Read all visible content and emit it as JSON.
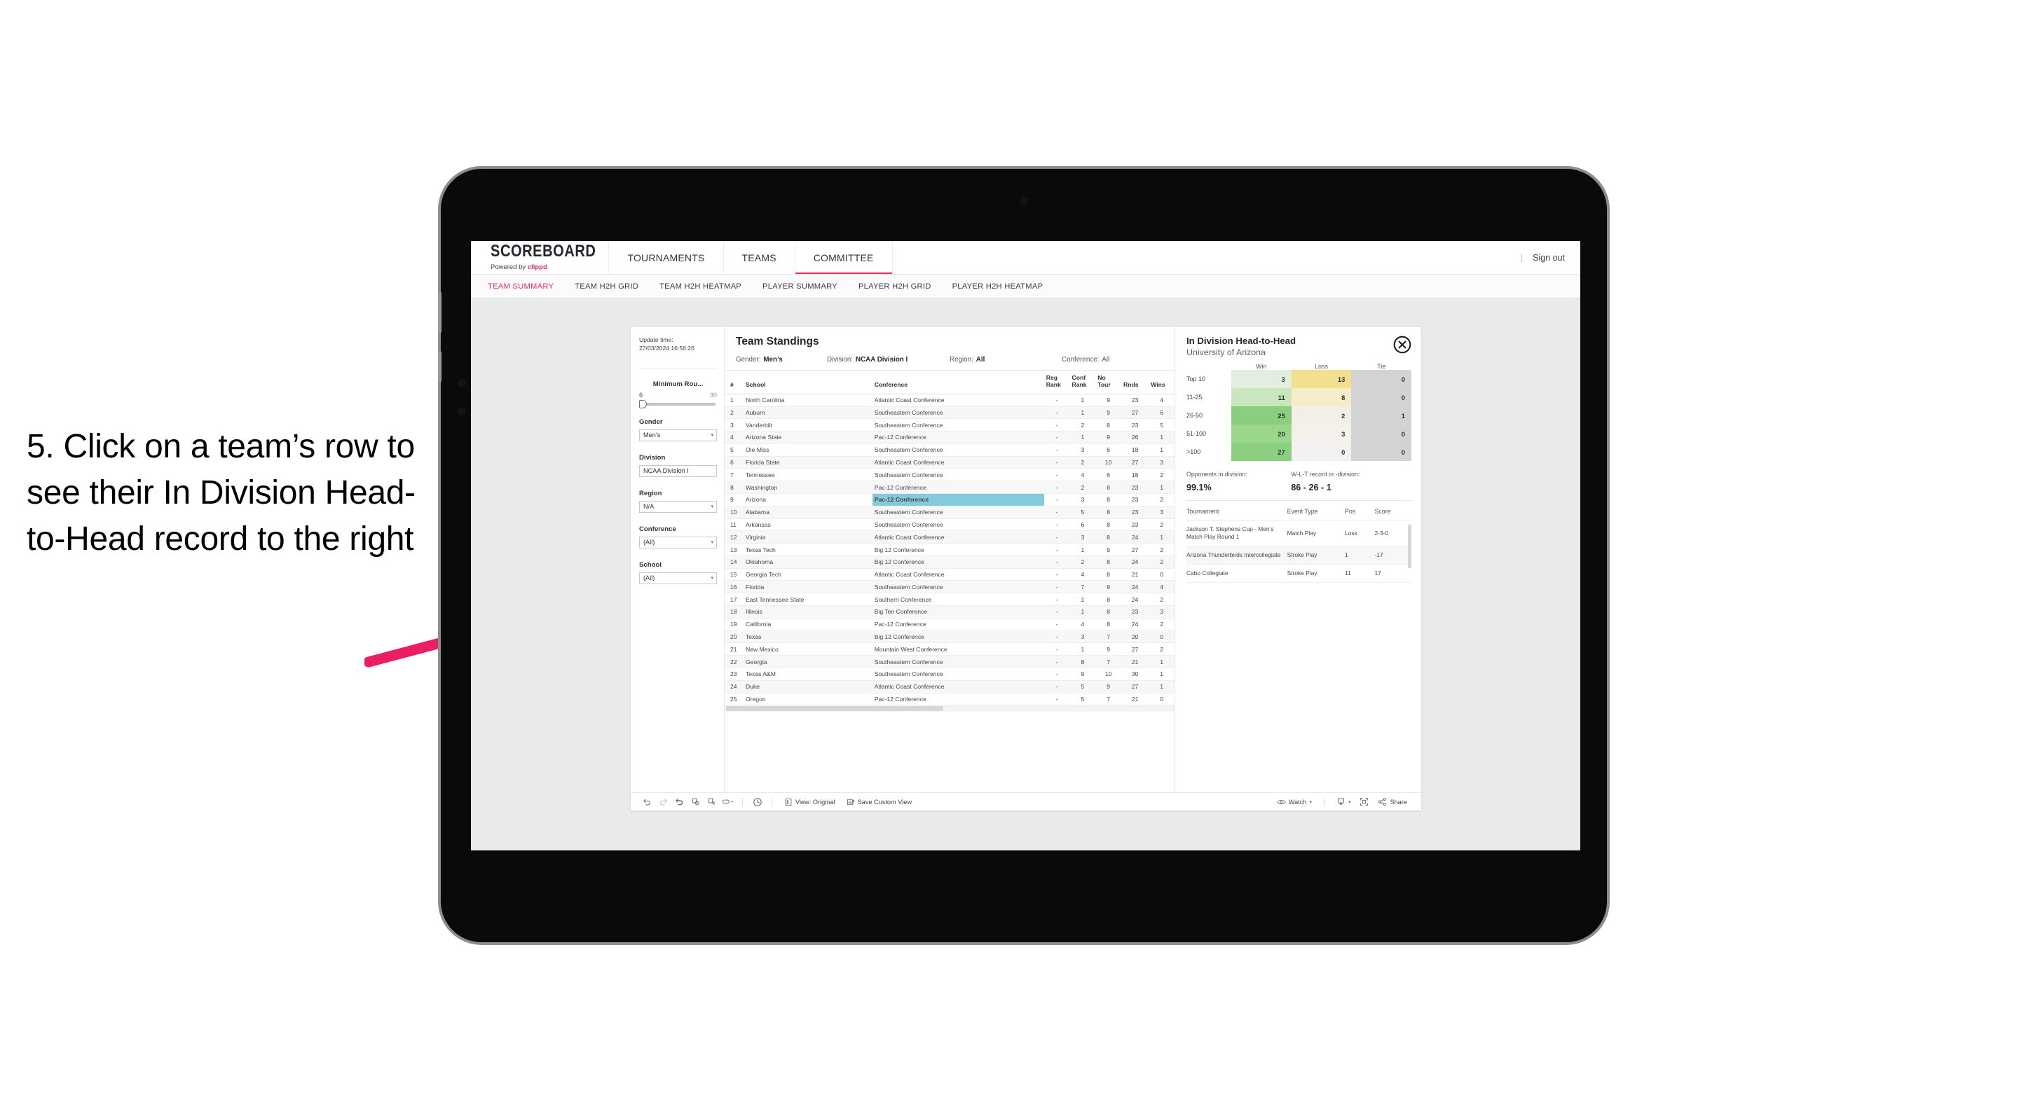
{
  "annotation": {
    "text": "5. Click on a team’s row to see their In Division Head-to-Head record to the right",
    "arrow_color": "#ec1e63"
  },
  "topnav": {
    "brand_title": "SCOREBOARD",
    "brand_sub_prefix": "Powered by ",
    "brand_sub_brand": "clippd",
    "items": [
      {
        "label": "TOURNAMENTS",
        "active": false
      },
      {
        "label": "TEAMS",
        "active": false
      },
      {
        "label": "COMMITTEE",
        "active": true
      }
    ],
    "separator": "|",
    "sign_out": "Sign out",
    "accent_color": "#ef2b5c"
  },
  "subnav": {
    "items": [
      {
        "label": "TEAM SUMMARY",
        "active": true
      },
      {
        "label": "TEAM H2H GRID",
        "active": false
      },
      {
        "label": "TEAM H2H HEATMAP",
        "active": false
      },
      {
        "label": "PLAYER SUMMARY",
        "active": false
      },
      {
        "label": "PLAYER H2H GRID",
        "active": false
      },
      {
        "label": "PLAYER H2H HEATMAP",
        "active": false
      }
    ]
  },
  "filters": {
    "update_time_label": "Update time:",
    "update_time_value": "27/03/2024 16:56:26",
    "minimum_rounds": {
      "label": "Minimum Rou...",
      "min": "6",
      "max": "30",
      "value": 6
    },
    "groups": [
      {
        "label": "Gender",
        "value": "Men’s",
        "caret": "▾"
      },
      {
        "label": "Division",
        "value": "NCAA Division I",
        "caret": ""
      },
      {
        "label": "Region",
        "value": "N/A",
        "caret": "▾"
      },
      {
        "label": "Conference",
        "value": "(All)",
        "caret": "▾"
      },
      {
        "label": "School",
        "value": "(All)",
        "caret": "▾"
      }
    ]
  },
  "viz": {
    "title": "Team Standings",
    "meta": [
      {
        "label": "Gender:",
        "value": "Men’s"
      },
      {
        "label": "Division:",
        "value": "NCAA Division I"
      },
      {
        "label": "Region:",
        "value": "All"
      },
      {
        "label": "Conference:",
        "value": "All"
      }
    ],
    "columns": [
      "#",
      "School",
      "Conference",
      "Reg Rank",
      "Conf Rank",
      "No Tour",
      "Rnds",
      "Wins"
    ],
    "columns_wrapped": [
      {
        "l1": "#",
        "l2": ""
      },
      {
        "l1": "School",
        "l2": ""
      },
      {
        "l1": "Conference",
        "l2": ""
      },
      {
        "l1": "Reg",
        "l2": "Rank"
      },
      {
        "l1": "Conf",
        "l2": "Rank"
      },
      {
        "l1": "No",
        "l2": "Tour"
      },
      {
        "l1": "Rnds",
        "l2": ""
      },
      {
        "l1": "Wins",
        "l2": ""
      }
    ],
    "highlight_color": "#84cada",
    "rows": [
      {
        "rank": "1",
        "school": "North Carolina",
        "conference": "Atlantic Coast Conference",
        "reg_rank": "-",
        "conf_rank": "1",
        "no_tour": "9",
        "rnds": "23",
        "wins": "4"
      },
      {
        "rank": "2",
        "school": "Auburn",
        "conference": "Southeastern Conference",
        "reg_rank": "-",
        "conf_rank": "1",
        "no_tour": "9",
        "rnds": "27",
        "wins": "6"
      },
      {
        "rank": "3",
        "school": "Vanderbilt",
        "conference": "Southeastern Conference",
        "reg_rank": "-",
        "conf_rank": "2",
        "no_tour": "8",
        "rnds": "23",
        "wins": "5"
      },
      {
        "rank": "4",
        "school": "Arizona State",
        "conference": "Pac-12 Conference",
        "reg_rank": "-",
        "conf_rank": "1",
        "no_tour": "9",
        "rnds": "26",
        "wins": "1"
      },
      {
        "rank": "5",
        "school": "Ole Miss",
        "conference": "Southeastern Conference",
        "reg_rank": "-",
        "conf_rank": "3",
        "no_tour": "6",
        "rnds": "18",
        "wins": "1"
      },
      {
        "rank": "6",
        "school": "Florida State",
        "conference": "Atlantic Coast Conference",
        "reg_rank": "-",
        "conf_rank": "2",
        "no_tour": "10",
        "rnds": "27",
        "wins": "3"
      },
      {
        "rank": "7",
        "school": "Tennessee",
        "conference": "Southeastern Conference",
        "reg_rank": "-",
        "conf_rank": "4",
        "no_tour": "6",
        "rnds": "18",
        "wins": "2"
      },
      {
        "rank": "8",
        "school": "Washington",
        "conference": "Pac-12 Conference",
        "reg_rank": "-",
        "conf_rank": "2",
        "no_tour": "8",
        "rnds": "23",
        "wins": "1"
      },
      {
        "rank": "9",
        "school": "Arizona",
        "conference": "Pac-12 Conference",
        "reg_rank": "-",
        "conf_rank": "3",
        "no_tour": "8",
        "rnds": "23",
        "wins": "2",
        "selected": true
      },
      {
        "rank": "10",
        "school": "Alabama",
        "conference": "Southeastern Conference",
        "reg_rank": "-",
        "conf_rank": "5",
        "no_tour": "8",
        "rnds": "23",
        "wins": "3"
      },
      {
        "rank": "11",
        "school": "Arkansas",
        "conference": "Southeastern Conference",
        "reg_rank": "-",
        "conf_rank": "6",
        "no_tour": "8",
        "rnds": "23",
        "wins": "2"
      },
      {
        "rank": "12",
        "school": "Virginia",
        "conference": "Atlantic Coast Conference",
        "reg_rank": "-",
        "conf_rank": "3",
        "no_tour": "8",
        "rnds": "24",
        "wins": "1"
      },
      {
        "rank": "13",
        "school": "Texas Tech",
        "conference": "Big 12 Conference",
        "reg_rank": "-",
        "conf_rank": "1",
        "no_tour": "9",
        "rnds": "27",
        "wins": "2"
      },
      {
        "rank": "14",
        "school": "Oklahoma",
        "conference": "Big 12 Conference",
        "reg_rank": "-",
        "conf_rank": "2",
        "no_tour": "8",
        "rnds": "24",
        "wins": "2"
      },
      {
        "rank": "15",
        "school": "Georgia Tech",
        "conference": "Atlantic Coast Conference",
        "reg_rank": "-",
        "conf_rank": "4",
        "no_tour": "8",
        "rnds": "21",
        "wins": "0"
      },
      {
        "rank": "16",
        "school": "Florida",
        "conference": "Southeastern Conference",
        "reg_rank": "-",
        "conf_rank": "7",
        "no_tour": "9",
        "rnds": "24",
        "wins": "4"
      },
      {
        "rank": "17",
        "school": "East Tennessee State",
        "conference": "Southern Conference",
        "reg_rank": "-",
        "conf_rank": "1",
        "no_tour": "8",
        "rnds": "24",
        "wins": "2"
      },
      {
        "rank": "18",
        "school": "Illinois",
        "conference": "Big Ten Conference",
        "reg_rank": "-",
        "conf_rank": "1",
        "no_tour": "8",
        "rnds": "23",
        "wins": "3"
      },
      {
        "rank": "19",
        "school": "California",
        "conference": "Pac-12 Conference",
        "reg_rank": "-",
        "conf_rank": "4",
        "no_tour": "8",
        "rnds": "24",
        "wins": "2"
      },
      {
        "rank": "20",
        "school": "Texas",
        "conference": "Big 12 Conference",
        "reg_rank": "-",
        "conf_rank": "3",
        "no_tour": "7",
        "rnds": "20",
        "wins": "0"
      },
      {
        "rank": "21",
        "school": "New Mexico",
        "conference": "Mountain West Conference",
        "reg_rank": "-",
        "conf_rank": "1",
        "no_tour": "9",
        "rnds": "27",
        "wins": "2"
      },
      {
        "rank": "22",
        "school": "Georgia",
        "conference": "Southeastern Conference",
        "reg_rank": "-",
        "conf_rank": "8",
        "no_tour": "7",
        "rnds": "21",
        "wins": "1"
      },
      {
        "rank": "23",
        "school": "Texas A&M",
        "conference": "Southeastern Conference",
        "reg_rank": "-",
        "conf_rank": "9",
        "no_tour": "10",
        "rnds": "30",
        "wins": "1"
      },
      {
        "rank": "24",
        "school": "Duke",
        "conference": "Atlantic Coast Conference",
        "reg_rank": "-",
        "conf_rank": "5",
        "no_tour": "9",
        "rnds": "27",
        "wins": "1"
      },
      {
        "rank": "25",
        "school": "Oregon",
        "conference": "Pac-12 Conference",
        "reg_rank": "-",
        "conf_rank": "5",
        "no_tour": "7",
        "rnds": "21",
        "wins": "0"
      }
    ]
  },
  "h2h": {
    "title": "In Division Head-to-Head",
    "subtitle": "University of Arizona",
    "close_icon": "close-circle-icon",
    "chart_data": {
      "type": "heatmap",
      "title": "In Division Head-to-Head",
      "subtitle": "University of Arizona",
      "columns": [
        "Win",
        "Loss",
        "Tie"
      ],
      "rows": [
        "Top 10",
        "11-25",
        "26-50",
        "51-100",
        ">100"
      ],
      "values": [
        [
          3,
          13,
          0
        ],
        [
          11,
          8,
          0
        ],
        [
          25,
          2,
          1
        ],
        [
          20,
          3,
          0
        ],
        [
          27,
          0,
          0
        ]
      ],
      "cell_colors": [
        [
          "#e2eede",
          "#f2e08f",
          "#d3d3d3"
        ],
        [
          "#c9e6bd",
          "#f5ecc9",
          "#d3d3d3"
        ],
        [
          "#8ace7f",
          "#f1efe6",
          "#d3d3d3"
        ],
        [
          "#9ad78c",
          "#f3f1ea",
          "#d3d3d3"
        ],
        [
          "#8dcf81",
          "#f2f2f0",
          "#d3d3d3"
        ]
      ]
    },
    "stats": [
      {
        "label": "Opponents in division:",
        "value": "99.1%"
      },
      {
        "label": "W-L-T record in -division:",
        "value": "86 - 26 - 1"
      }
    ],
    "tournament_columns": [
      "Tournament",
      "Event Type",
      "Pos",
      "Score"
    ],
    "tournaments": [
      {
        "name": "Jackson T. Stephens Cup - Men’s Match Play Round 1",
        "event_type": "Match Play",
        "pos": "Loss",
        "score": "2-3-0"
      },
      {
        "name": "Arizona Thunderbirds Intercollegiate",
        "event_type": "Stroke Play",
        "pos": "1",
        "score": "-17"
      },
      {
        "name": "Cabo Collegiate",
        "event_type": "Stroke Play",
        "pos": "11",
        "score": "17"
      }
    ]
  },
  "toolbar": {
    "icons": [
      {
        "name": "undo-icon"
      },
      {
        "name": "redo-icon"
      },
      {
        "name": "revert-icon"
      },
      {
        "name": "refresh-data-icon"
      },
      {
        "name": "pause-auto-updates-icon"
      },
      {
        "name": "highlight-dropdown-icon"
      }
    ],
    "history_icon": "history-icon",
    "view_button": "View: Original",
    "view_icon": "view-original-icon",
    "save_button": "Save Custom View",
    "save_icon": "save-custom-view-icon",
    "watch_button": "Watch",
    "watch_icon": "eye-icon",
    "download_icon": "download-icon",
    "fullscreen_icon": "fullscreen-icon",
    "share_button": "Share",
    "share_icon": "share-icon",
    "caret": "▾"
  }
}
